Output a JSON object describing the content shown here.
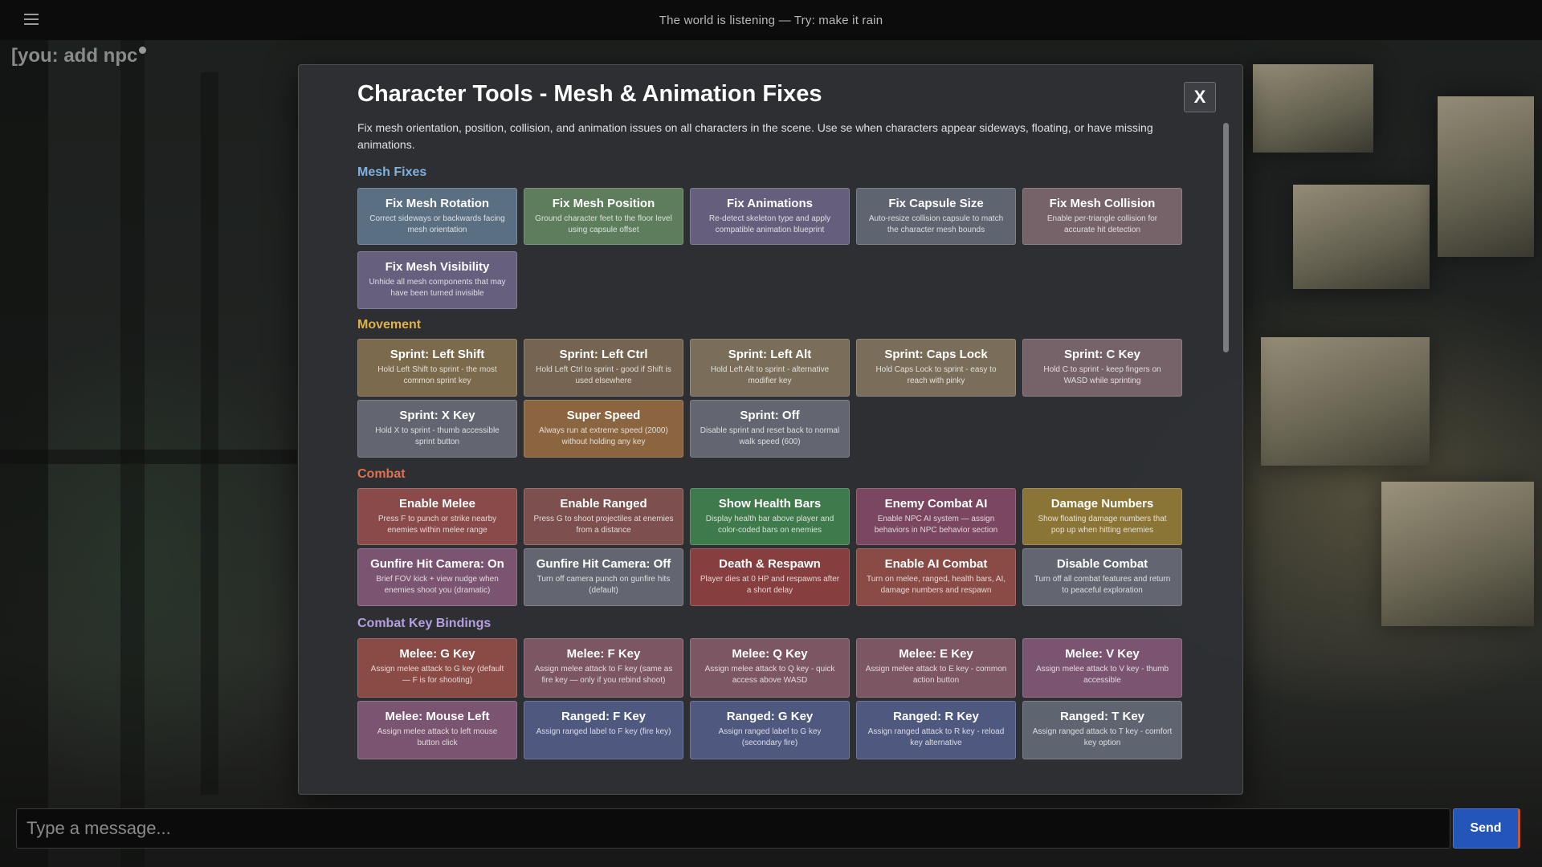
{
  "topbar": {
    "center_text": "The world is listening — Try: make it rain"
  },
  "user_line": "[you: add npc",
  "modal": {
    "title": "Character Tools - Mesh & Animation Fixes",
    "close_label": "X",
    "description": "Fix mesh orientation, position, collision, and animation issues on all characters in the scene. Use se when characters appear sideways, floating, or have missing animations."
  },
  "sections": {
    "mesh": {
      "title": "Mesh Fixes",
      "color": "#7fb2e0"
    },
    "movement": {
      "title": "Movement",
      "color": "#e0b24a"
    },
    "combat": {
      "title": "Combat",
      "color": "#e2704f"
    },
    "keys": {
      "title": "Combat Key Bindings",
      "color": "#b79ee0"
    }
  },
  "buttons": {
    "mesh_rotation": {
      "title": "Fix Mesh Rotation",
      "desc": "Correct sideways or backwards facing mesh orientation"
    },
    "mesh_position": {
      "title": "Fix Mesh Position",
      "desc": "Ground character feet to the floor level using capsule offset"
    },
    "animations": {
      "title": "Fix Animations",
      "desc": "Re-detect skeleton type and apply compatible animation blueprint"
    },
    "capsule_size": {
      "title": "Fix Capsule Size",
      "desc": "Auto-resize collision capsule to match the character mesh bounds"
    },
    "mesh_collision": {
      "title": "Fix Mesh Collision",
      "desc": "Enable per-triangle collision for accurate hit detection"
    },
    "mesh_visibility": {
      "title": "Fix Mesh Visibility",
      "desc": "Unhide all mesh components that may have been turned invisible"
    },
    "sprint_shift": {
      "title": "Sprint: Left Shift",
      "desc": "Hold Left Shift to sprint - the most common sprint key"
    },
    "sprint_ctrl": {
      "title": "Sprint: Left Ctrl",
      "desc": "Hold Left Ctrl to sprint - good if Shift is used elsewhere"
    },
    "sprint_alt": {
      "title": "Sprint: Left Alt",
      "desc": "Hold Left Alt to sprint - alternative modifier key"
    },
    "sprint_caps": {
      "title": "Sprint: Caps Lock",
      "desc": "Hold Caps Lock to sprint - easy to reach with pinky"
    },
    "sprint_c": {
      "title": "Sprint: C Key",
      "desc": "Hold C to sprint - keep fingers on WASD while sprinting"
    },
    "sprint_x": {
      "title": "Sprint: X Key",
      "desc": "Hold X to sprint - thumb accessible sprint button"
    },
    "super_speed": {
      "title": "Super Speed",
      "desc": "Always run at extreme speed (2000) without holding any key"
    },
    "sprint_off": {
      "title": "Sprint: Off",
      "desc": "Disable sprint and reset back to normal walk speed (600)"
    },
    "enable_melee": {
      "title": "Enable Melee",
      "desc": "Press F to punch or strike nearby enemies within melee range"
    },
    "enable_ranged": {
      "title": "Enable Ranged",
      "desc": "Press G to shoot projectiles at enemies from a distance"
    },
    "health_bars": {
      "title": "Show Health Bars",
      "desc": "Display health bar above player and color-coded bars on enemies"
    },
    "enemy_ai": {
      "title": "Enemy Combat AI",
      "desc": "Enable NPC AI system — assign behaviors in NPC behavior section"
    },
    "damage_numbers": {
      "title": "Damage Numbers",
      "desc": "Show floating damage numbers that pop up when hitting enemies"
    },
    "hitcam_on": {
      "title": "Gunfire Hit Camera: On",
      "desc": "Brief FOV kick + view nudge when enemies shoot you (dramatic)"
    },
    "hitcam_off": {
      "title": "Gunfire Hit Camera: Off",
      "desc": "Turn off camera punch on gunfire hits (default)"
    },
    "death_respawn": {
      "title": "Death & Respawn",
      "desc": "Player dies at 0 HP and respawns after a short delay"
    },
    "enable_ai_combat": {
      "title": "Enable AI Combat",
      "desc": "Turn on melee, ranged, health bars, AI, damage numbers and respawn"
    },
    "disable_combat": {
      "title": "Disable Combat",
      "desc": "Turn off all combat features and return to peaceful exploration"
    },
    "melee_g": {
      "title": "Melee: G Key",
      "desc": "Assign melee attack to G key (default — F is for shooting)"
    },
    "melee_f": {
      "title": "Melee: F Key",
      "desc": "Assign melee attack to F key (same as fire key — only if you rebind shoot)"
    },
    "melee_q": {
      "title": "Melee: Q Key",
      "desc": "Assign melee attack to Q key - quick access above WASD"
    },
    "melee_e": {
      "title": "Melee: E Key",
      "desc": "Assign melee attack to E key - common action button"
    },
    "melee_v": {
      "title": "Melee: V Key",
      "desc": "Assign melee attack to V key - thumb accessible"
    },
    "melee_mouse": {
      "title": "Melee: Mouse Left",
      "desc": "Assign melee attack to left mouse button click"
    },
    "ranged_f": {
      "title": "Ranged: F Key",
      "desc": "Assign ranged label to F key (fire key)"
    },
    "ranged_g": {
      "title": "Ranged: G Key",
      "desc": "Assign ranged label to G key (secondary fire)"
    },
    "ranged_r": {
      "title": "Ranged: R Key",
      "desc": "Assign ranged attack to R key - reload key alternative"
    },
    "ranged_t": {
      "title": "Ranged: T Key",
      "desc": "Assign ranged attack to T key - comfort key option"
    }
  },
  "chat": {
    "placeholder": "Type a message...",
    "send_label": "Send"
  }
}
